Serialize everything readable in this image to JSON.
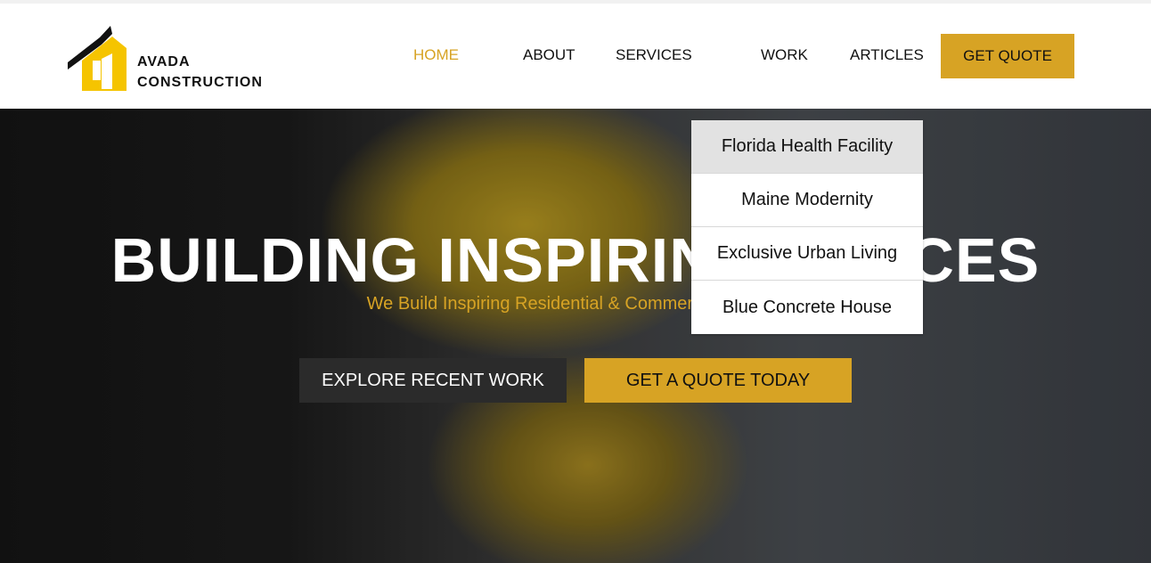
{
  "brand": {
    "line1": "AVADA",
    "line2": "CONSTRUCTION"
  },
  "nav": {
    "items": [
      {
        "label": "HOME",
        "active": true
      },
      {
        "label": "ABOUT"
      },
      {
        "label": "SERVICES"
      },
      {
        "label": "WORK"
      },
      {
        "label": "ARTICLES"
      }
    ],
    "cta": "GET QUOTE"
  },
  "hero": {
    "headline": "BUILDING INSPIRING SPACES",
    "subline": "We Build Inspiring Residential & Commercial Spaces",
    "explore_button": "EXPLORE RECENT WORK",
    "quote_button": "GET A QUOTE TODAY"
  },
  "work_dropdown": {
    "items": [
      "Florida Health Facility",
      "Maine Modernity",
      "Exclusive Urban Living",
      "Blue Concrete House"
    ]
  },
  "colors": {
    "accent": "#d7a324",
    "dark": "#2b2b2b",
    "text": "#111111"
  }
}
